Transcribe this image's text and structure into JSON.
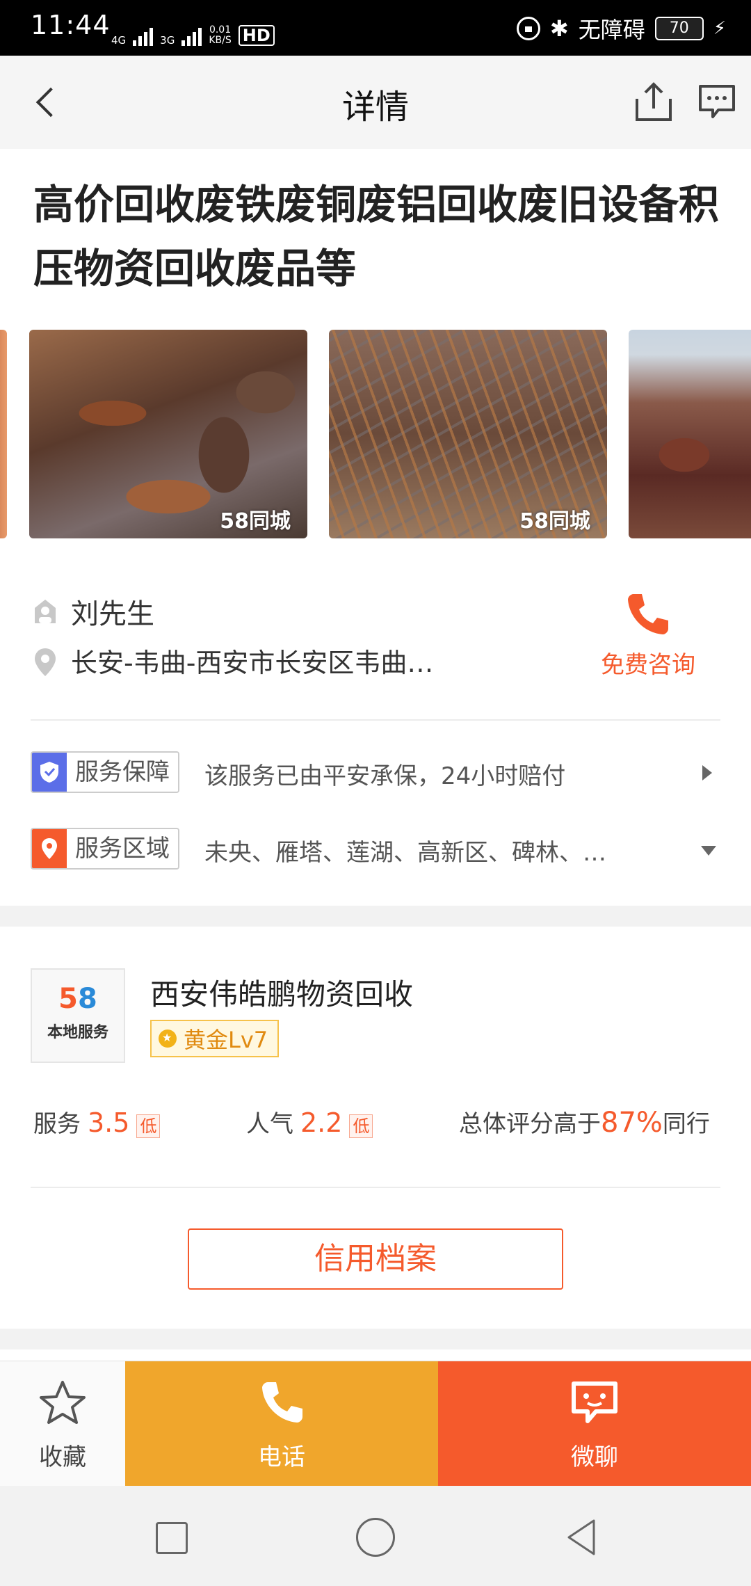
{
  "status_bar": {
    "time": "11:44",
    "network_1": "4G",
    "network_2": "3G",
    "speed_value": "0.01",
    "speed_unit": "KB/S",
    "hd": "HD",
    "accessibility": "无障碍",
    "battery": "70"
  },
  "header": {
    "title": "详情"
  },
  "post": {
    "title": "高价回收废铁废铜废铝回收废旧设备积压物资回收废品等",
    "image_watermark": "58同城"
  },
  "contact": {
    "name": "刘先生",
    "address": "长安-韦曲-西安市长安区韦曲…",
    "consult_label": "免费咨询"
  },
  "services": [
    {
      "badge": "服务保障",
      "text": "该服务已由平安承保，24小时赔付",
      "icon": "shield-icon",
      "color": "#5b6ee8"
    },
    {
      "badge": "服务区域",
      "text": "未央、雁塔、莲湖、高新区、碑林、…",
      "icon": "location-pin-icon",
      "color": "#f55a2c"
    }
  ],
  "shop": {
    "logo_number_5": "5",
    "logo_number_8": "8",
    "logo_sub": "本地服务",
    "name": "西安伟皓鹏物资回收",
    "level": "黄金Lv7"
  },
  "stats": {
    "service_label": "服务",
    "service_value": "3.5",
    "service_tag": "低",
    "popularity_label": "人气",
    "popularity_value": "2.2",
    "popularity_tag": "低",
    "overall_prefix": "总体评分高于",
    "overall_pct": "87%",
    "overall_suffix": "同行"
  },
  "credit_button": "信用档案",
  "actions": {
    "favorite": "收藏",
    "call": "电话",
    "chat": "微聊"
  },
  "colors": {
    "accent": "#f55a2c",
    "call": "#f0a62c",
    "gold": "#f2b218"
  }
}
